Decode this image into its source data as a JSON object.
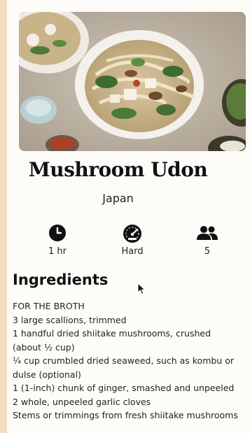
{
  "recipe": {
    "title": "Mushroom Udon",
    "origin": "Japan",
    "stats": {
      "time": {
        "label": "1 hr",
        "icon": "clock-icon"
      },
      "difficulty": {
        "label": "Hard",
        "icon": "speedometer-icon"
      },
      "servings": {
        "label": "5",
        "icon": "people-icon"
      }
    },
    "ingredients_heading": "Ingredients",
    "ingredients": [
      "FOR THE BROTH",
      "3 large scallions, trimmed",
      "1 handful dried shiitake mushrooms, crushed (about ½ cup)",
      "¼ cup crumbled dried seaweed, such as kombu or dulse (optional)",
      "1 (1-inch) chunk of ginger, smashed and unpeeled",
      "2 whole, unpeeled garlic cloves",
      "Stems or trimmings from fresh shiitake mushrooms"
    ]
  },
  "colors": {
    "page_background": "#f7dcc4",
    "card_background": "#fefcf9"
  }
}
